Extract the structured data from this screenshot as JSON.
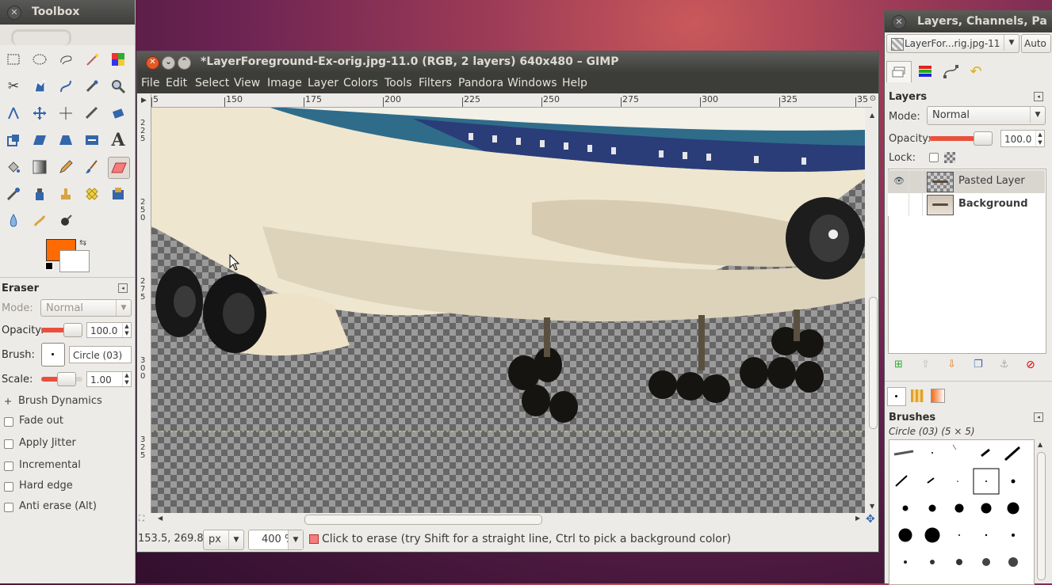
{
  "toolbox": {
    "title": "Toolbox",
    "tool_options_title": "Eraser",
    "mode_label": "Mode:",
    "mode_value": "Normal",
    "opacity_label": "Opacity:",
    "opacity_value": "100.0",
    "brush_label": "Brush:",
    "brush_value": "Circle (03)",
    "scale_label": "Scale:",
    "scale_value": "1.00",
    "brush_dynamics": "Brush Dynamics",
    "options": [
      {
        "label": "Fade out",
        "checked": false
      },
      {
        "label": "Apply Jitter",
        "checked": false
      },
      {
        "label": "Incremental",
        "checked": false
      },
      {
        "label": "Hard edge",
        "checked": false
      },
      {
        "label": "Anti erase  (Alt)",
        "checked": false
      }
    ],
    "fg_color": "#ff6b00",
    "bg_color": "#ffffff"
  },
  "image_window": {
    "title": "*LayerForeground-Ex-orig.jpg-11.0 (RGB, 2 layers) 640x480 – GIMP",
    "menus": [
      "File",
      "Edit",
      "Select",
      "View",
      "Image",
      "Layer",
      "Colors",
      "Tools",
      "Filters",
      "Pandora",
      "Windows",
      "Help"
    ],
    "ruler_h_labels": [
      "5",
      "150",
      "175",
      "200",
      "225",
      "250",
      "275",
      "300",
      "325",
      "35"
    ],
    "ruler_v_labels": [
      "225",
      "250",
      "275",
      "300",
      "325"
    ],
    "status": {
      "coords": "153.5, 269.8",
      "unit": "px",
      "zoom": "400 %",
      "message": "Click to erase (try Shift for a straight line, Ctrl to pick a background color)"
    }
  },
  "dock": {
    "title": "Layers, Channels, Pa",
    "image_selector": "LayerFor...rig.jpg-11",
    "auto_button": "Auto",
    "layers_title": "Layers",
    "mode_label": "Mode:",
    "mode_value": "Normal",
    "opacity_label": "Opacity:",
    "opacity_value": "100.0",
    "lock_label": "Lock:",
    "layers": [
      {
        "name": "Pasted Layer",
        "visible": true,
        "selected": true
      },
      {
        "name": "Background",
        "visible": false,
        "selected": false
      }
    ],
    "brushes_title": "Brushes",
    "brush_name": "Circle (03) (5 × 5)"
  }
}
